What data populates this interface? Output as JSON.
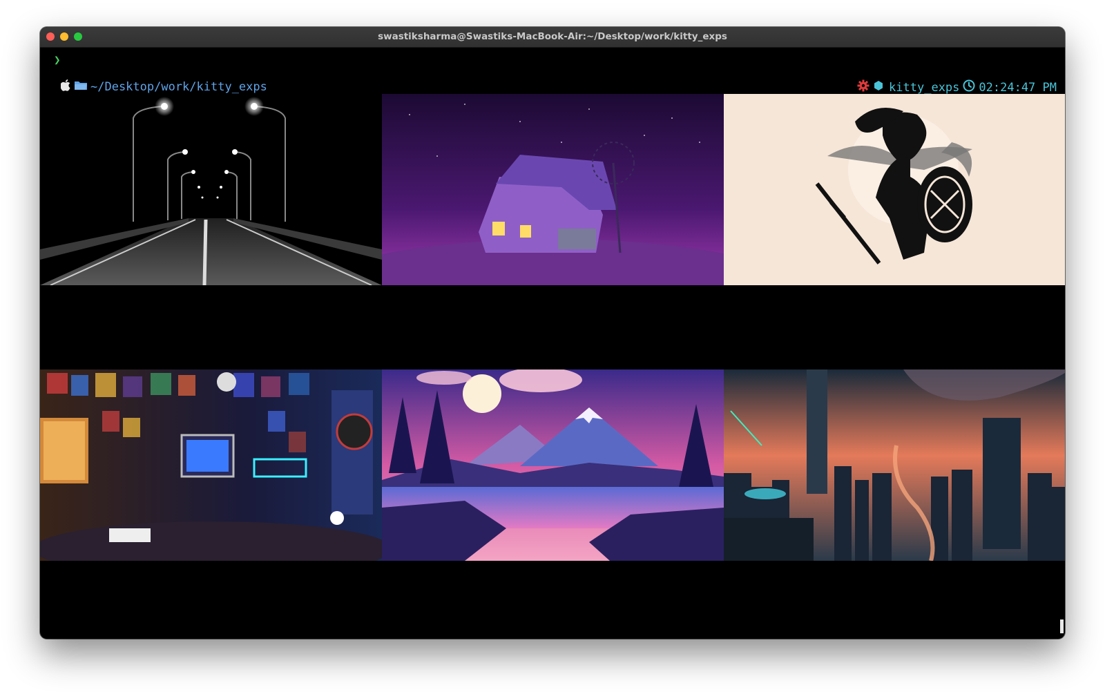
{
  "window": {
    "title": "swastiksharma@Swastiks-MacBook-Air:~/Desktop/work/kitty_exps"
  },
  "prompt": {
    "symbol": "❯",
    "path": "~/Desktop/work/kitty_exps",
    "project": "kitty_exps",
    "time": "02:24:47 PM",
    "icons": [
      "apple-icon",
      "folder-icon",
      "gear-icon",
      "cube-icon",
      "clock-icon"
    ]
  },
  "colors": {
    "prompt_green": "#46d160",
    "path_blue": "#5fa3e8",
    "segment_cyan": "#49c4d8",
    "gear_red": "#e03b3b"
  },
  "images": [
    {
      "subject": "night-highway-image"
    },
    {
      "subject": "purple-farmhouse-image"
    },
    {
      "subject": "warrior-silhouette-image"
    },
    {
      "subject": "retro-room-image"
    },
    {
      "subject": "mountain-lake-image"
    },
    {
      "subject": "futuristic-city-image"
    }
  ]
}
